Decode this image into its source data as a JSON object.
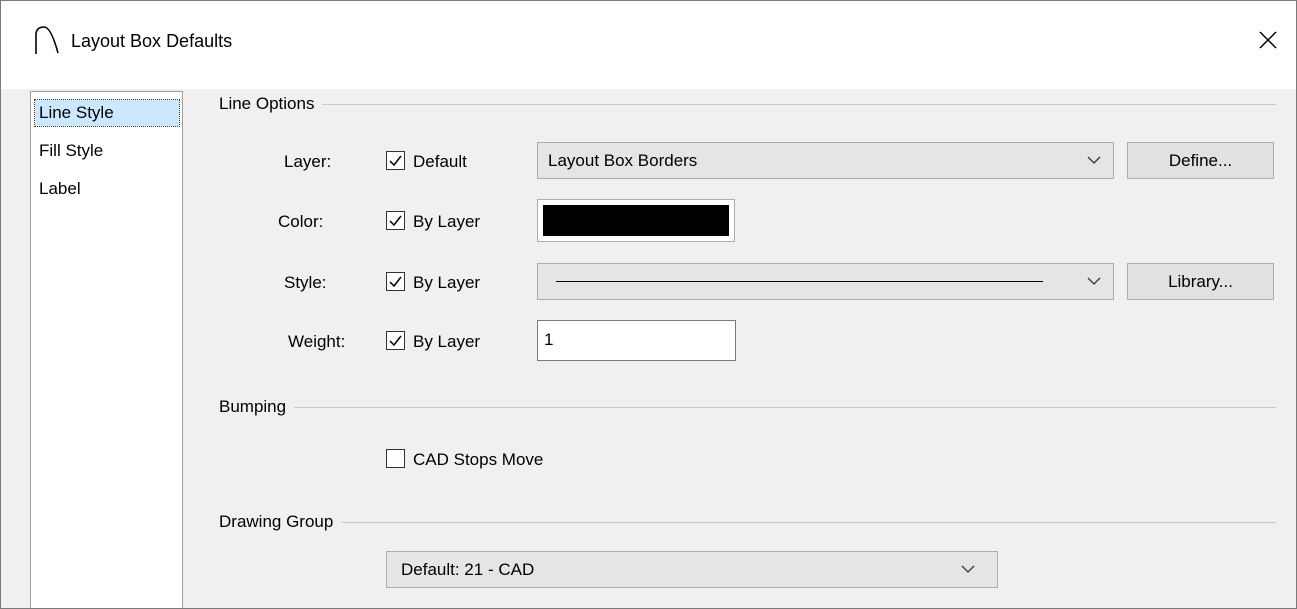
{
  "window": {
    "title": "Layout Box Defaults"
  },
  "sidebar": {
    "items": [
      {
        "label": "Line Style",
        "selected": true
      },
      {
        "label": "Fill Style",
        "selected": false
      },
      {
        "label": "Label",
        "selected": false
      }
    ]
  },
  "line_options": {
    "title": "Line Options",
    "layer": {
      "label": "Layer:",
      "check_label": "Default",
      "checked": true,
      "value": "Layout Box Borders",
      "button": "Define..."
    },
    "color": {
      "label": "Color:",
      "check_label": "By Layer",
      "checked": true,
      "swatch_color": "#000000"
    },
    "style": {
      "label": "Style:",
      "check_label": "By Layer",
      "checked": true,
      "button": "Library..."
    },
    "weight": {
      "label": "Weight:",
      "check_label": "By Layer",
      "checked": true,
      "value": "1"
    }
  },
  "bumping": {
    "title": "Bumping",
    "cad_stops_move": {
      "label": "CAD Stops Move",
      "checked": false
    }
  },
  "drawing_group": {
    "title": "Drawing Group",
    "value": "Default: 21 - CAD"
  }
}
